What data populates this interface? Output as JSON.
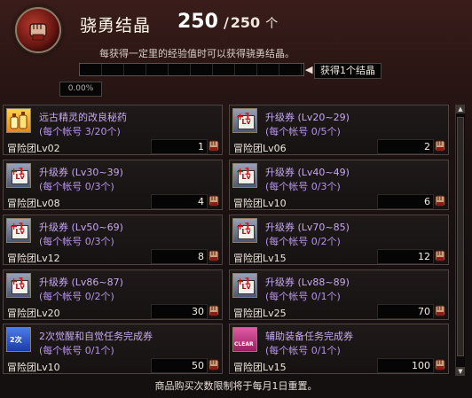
{
  "header": {
    "title": "骁勇结晶",
    "current": "250",
    "separator": "/",
    "max": "250",
    "unit": "个",
    "notice": "每获得一定里的经验值时可以获得骁勇结晶。",
    "progress_percent": "0.00%",
    "progress_value": 0.0,
    "reward_label": "获得1个结晶",
    "badge_icon": "fist-icon"
  },
  "items": [
    {
      "name": "远古精灵的改良秘药",
      "limit": "(每个帐号 3/20个)",
      "req": "冒险团Lv02",
      "price": "1",
      "icon": "potion"
    },
    {
      "name": "升级券 (Lv20~29)",
      "limit": "(每个帐号 0/5个)",
      "req": "冒险团Lv06",
      "price": "2",
      "icon": "ticket"
    },
    {
      "name": "升级券 (Lv30~39)",
      "limit": "(每个帐号 0/3个)",
      "req": "冒险团Lv08",
      "price": "4",
      "icon": "ticket"
    },
    {
      "name": "升级券 (Lv40~49)",
      "limit": "(每个帐号 0/3个)",
      "req": "冒险团Lv10",
      "price": "6",
      "icon": "ticket"
    },
    {
      "name": "升级券 (Lv50~69)",
      "limit": "(每个帐号 0/3个)",
      "req": "冒险团Lv12",
      "price": "8",
      "icon": "ticket"
    },
    {
      "name": "升级券 (Lv70~85)",
      "limit": "(每个帐号 0/2个)",
      "req": "冒险团Lv15",
      "price": "12",
      "icon": "ticket"
    },
    {
      "name": "升级券 (Lv86~87)",
      "limit": "(每个帐号 0/2个)",
      "req": "冒险团Lv20",
      "price": "30",
      "icon": "ticket"
    },
    {
      "name": "升级券 (Lv88~89)",
      "limit": "(每个帐号 0/1个)",
      "req": "冒险团Lv25",
      "price": "70",
      "icon": "ticket"
    },
    {
      "name": "2次觉醒和自觉任务完成券",
      "limit": "(每个帐号 0/1个)",
      "req": "冒险团Lv10",
      "price": "50",
      "icon": "awaken"
    },
    {
      "name": "辅助装备任务完成券",
      "limit": "(每个帐号 0/1个)",
      "req": "冒险团Lv15",
      "price": "100",
      "icon": "clear"
    }
  ],
  "ticket_icon_text": "Lv",
  "clear_icon_text": "CLEAR",
  "awaken_icon_text": "2次",
  "footer": "商品购买次数限制将于每月1日重置。",
  "colors": {
    "item_name": "#c6a7f1",
    "item_limit": "#b793e9",
    "accent_gold": "#c9a45a"
  }
}
